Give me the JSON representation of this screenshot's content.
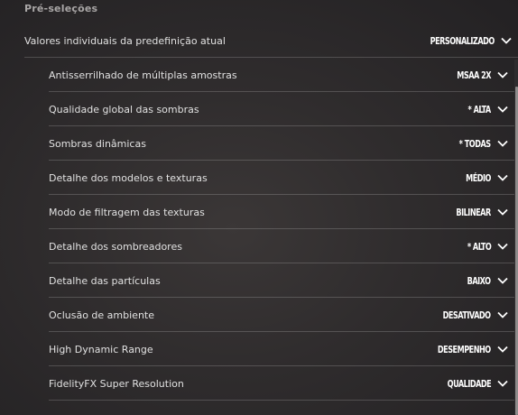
{
  "section": {
    "title": "Pré-seleções"
  },
  "preset": {
    "label": "Valores individuais da predefinição atual",
    "value": "PERSONALIZADO"
  },
  "settings": [
    {
      "label": "Antisserrilhado de múltiplas amostras",
      "value": "MSAA 2X"
    },
    {
      "label": "Qualidade global das sombras",
      "value": "* ALTA"
    },
    {
      "label": "Sombras dinâmicas",
      "value": "* TODAS"
    },
    {
      "label": "Detalhe dos modelos e texturas",
      "value": "MÉDIO"
    },
    {
      "label": "Modo de filtragem das texturas",
      "value": "BILINEAR"
    },
    {
      "label": "Detalhe dos sombreadores",
      "value": "* ALTO"
    },
    {
      "label": "Detalhe das partículas",
      "value": "BAIXO"
    },
    {
      "label": "Oclusão de ambiente",
      "value": "DESATIVADO"
    },
    {
      "label": "High Dynamic Range",
      "value": "DESEMPENHO"
    },
    {
      "label": "FidelityFX Super Resolution",
      "value": "QUALIDADE"
    }
  ],
  "icons": {
    "dropdown": "chevron-down-icon"
  },
  "colors": {
    "background": "#2f2c2d",
    "text": "#e1e1e1",
    "value": "#ffffff",
    "header": "#a9a6a6"
  }
}
